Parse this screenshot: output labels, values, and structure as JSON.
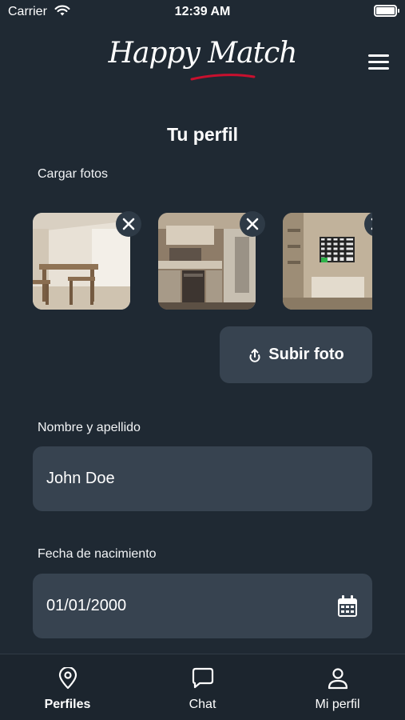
{
  "status_bar": {
    "carrier": "Carrier",
    "time": "12:39 AM"
  },
  "header": {
    "logo_text": "Happy Match",
    "menu_icon": "hamburger-menu-icon"
  },
  "page": {
    "title": "Tu perfil"
  },
  "photos": {
    "label": "Cargar fotos",
    "items": [
      {
        "name": "dining-room"
      },
      {
        "name": "kitchen"
      },
      {
        "name": "living-room"
      }
    ],
    "upload_label": "Subir foto"
  },
  "form": {
    "name_label": "Nombre y apellido",
    "name_value": "John Doe",
    "birth_label": "Fecha de nacimiento",
    "birth_value": "01/01/2000"
  },
  "tabs": [
    {
      "label": "Perfiles",
      "icon": "map-pin-icon",
      "active": true
    },
    {
      "label": "Chat",
      "icon": "chat-bubble-icon",
      "active": false
    },
    {
      "label": "Mi perfil",
      "icon": "user-icon",
      "active": false
    }
  ],
  "colors": {
    "background": "#1f2933",
    "field": "#374350",
    "accent_red": "#c8102e"
  }
}
